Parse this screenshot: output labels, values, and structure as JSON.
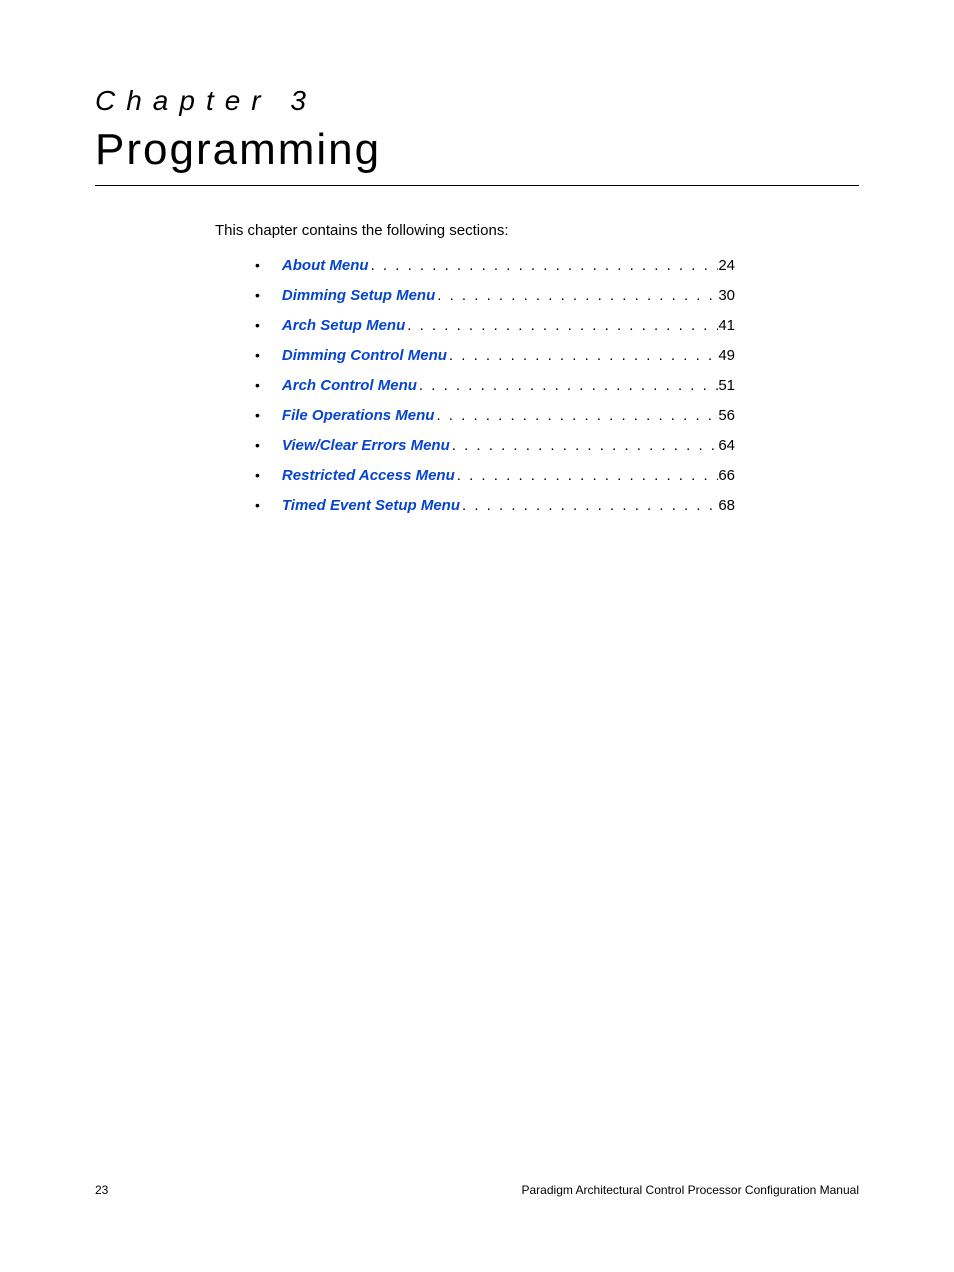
{
  "header": {
    "chapter_label": "Chapter 3",
    "chapter_title": "Programming"
  },
  "intro": "This chapter contains the following sections:",
  "toc": [
    {
      "label": "About Menu",
      "page": "24"
    },
    {
      "label": "Dimming Setup Menu",
      "page": "30"
    },
    {
      "label": "Arch Setup Menu",
      "page": "41"
    },
    {
      "label": "Dimming Control Menu",
      "page": "49"
    },
    {
      "label": "Arch Control Menu",
      "page": "51"
    },
    {
      "label": "File Operations Menu",
      "page": "56"
    },
    {
      "label": "View/Clear Errors Menu",
      "page": "64"
    },
    {
      "label": "Restricted Access Menu",
      "page": "66"
    },
    {
      "label": "Timed Event Setup Menu",
      "page": "68"
    }
  ],
  "footer": {
    "page_number": "23",
    "doc_title": "Paradigm Architectural Control Processor Configuration Manual"
  }
}
